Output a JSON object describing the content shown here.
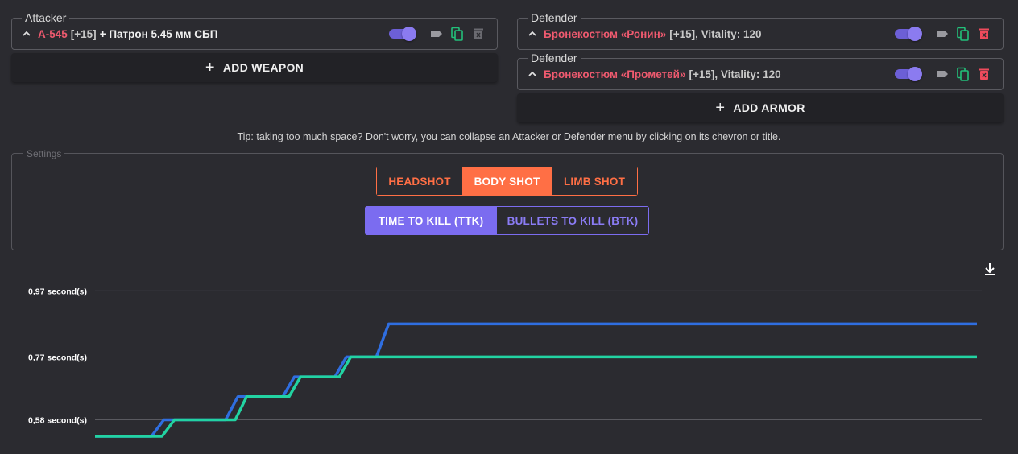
{
  "attacker": {
    "legend": "Attacker",
    "weapon_name": "А-545",
    "weapon_level": "[+15]",
    "ammo": "+ Патрон 5.45 мм СБП",
    "add_button": "ADD WEAPON"
  },
  "defenders": [
    {
      "legend": "Defender",
      "armor_name": "Бронекостюм «Ронин»",
      "level": "[+15]",
      "vitality": ", Vitality: 120"
    },
    {
      "legend": "Defender",
      "armor_name": "Бронекостюм «Прометей»",
      "level": "[+15]",
      "vitality": ", Vitality: 120"
    }
  ],
  "add_armor_button": "ADD ARMOR",
  "tip": "Tip: taking too much space? Don't worry, you can collapse an Attacker or Defender menu by clicking on its chevron or title.",
  "settings": {
    "legend": "Settings",
    "hit_options": [
      "HEADSHOT",
      "BODY SHOT",
      "LIMB SHOT"
    ],
    "hit_selected": "BODY SHOT",
    "mode_options": [
      "TIME TO KILL (TTK)",
      "BULLETS TO KILL (BTK)"
    ],
    "mode_selected": "TIME TO KILL (TTK)"
  },
  "icons": {
    "chevron": "chevron-up-icon",
    "toggle": "toggle-switch",
    "tag": "tag-icon",
    "copy": "copy-icon",
    "delete": "delete-icon",
    "download": "download-icon"
  },
  "colors": {
    "accent_orange": "#ff6f45",
    "accent_purple": "#7b6cf0",
    "name_red": "#ef5a6f",
    "series_blue": "#2f6ee0",
    "series_teal": "#22d3a2",
    "copy_green": "#22c07a",
    "delete_red": "#ef4b5c"
  },
  "chart_data": {
    "type": "line",
    "y_ticks": [
      "0,97 second(s)",
      "0,77 second(s)",
      "0,58 second(s)"
    ],
    "y_tick_values": [
      0.97,
      0.77,
      0.58
    ],
    "ylim": [
      0.53,
      1.0
    ],
    "xlim": [
      0,
      100
    ],
    "grid": true,
    "series": [
      {
        "color": "#2f6ee0",
        "points": [
          [
            0,
            0.53
          ],
          [
            6.4,
            0.53
          ],
          [
            7.8,
            0.58
          ],
          [
            14.8,
            0.58
          ],
          [
            16.2,
            0.65
          ],
          [
            21.3,
            0.65
          ],
          [
            22.6,
            0.71
          ],
          [
            27.2,
            0.71
          ],
          [
            28.5,
            0.77
          ],
          [
            31.9,
            0.77
          ],
          [
            33.3,
            0.87
          ],
          [
            100,
            0.87
          ]
        ]
      },
      {
        "color": "#22d3a2",
        "points": [
          [
            0,
            0.53
          ],
          [
            7.6,
            0.53
          ],
          [
            9.0,
            0.58
          ],
          [
            15.9,
            0.58
          ],
          [
            17.2,
            0.65
          ],
          [
            22.0,
            0.65
          ],
          [
            23.3,
            0.71
          ],
          [
            27.7,
            0.71
          ],
          [
            29.0,
            0.77
          ],
          [
            100,
            0.77
          ]
        ]
      }
    ]
  }
}
